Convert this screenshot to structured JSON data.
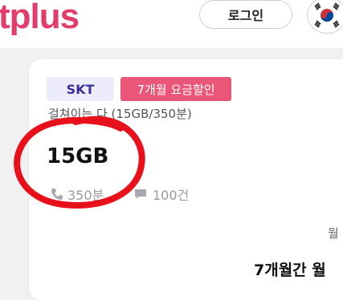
{
  "header": {
    "logo_text": "tplus",
    "login_label": "로그인",
    "language_icon": "korea-flag-icon"
  },
  "plan": {
    "carrier": "SKT",
    "discount_badge": "7개월 요금할인",
    "name": "걸쳐이는 다 (15GB/350분)",
    "data": "15GB",
    "voice": "350분",
    "sms": "100건",
    "voice_icon": "phone-icon",
    "sms_icon": "message-icon"
  },
  "side": {
    "label_partial": "월",
    "promo_title": "7개월간 월"
  },
  "colors": {
    "brand": "#e23c6a",
    "discount_badge_bg": "#ea5677",
    "carrier_badge_bg": "#ececfb",
    "carrier_text": "#3a2f9a",
    "annotation_circle": "#e8101a"
  }
}
